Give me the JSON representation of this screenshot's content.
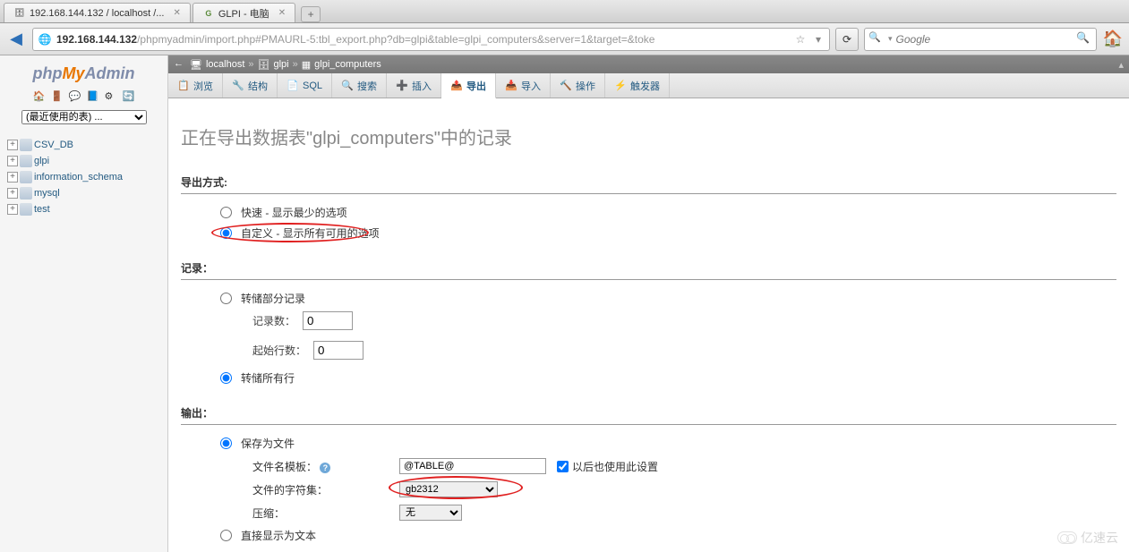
{
  "browser": {
    "tabs": [
      {
        "icon": "pma",
        "label": "192.168.144.132 / localhost /..."
      },
      {
        "icon": "glpi",
        "label": "GLPI - 电脑"
      }
    ],
    "url_host": "192.168.144.132",
    "url_path": "/phpmyadmin/import.php#PMAURL-5:tbl_export.php?db=glpi&table=glpi_computers&server=1&target=&toke",
    "search_placeholder": "Google"
  },
  "logo": {
    "p1": "php",
    "p2": "My",
    "p3": "Admin"
  },
  "recent_tables_label": "(最近使用的表) ...",
  "databases": [
    "CSV_DB",
    "glpi",
    "information_schema",
    "mysql",
    "test"
  ],
  "breadcrumb": {
    "server": "localhost",
    "db": "glpi",
    "table": "glpi_computers"
  },
  "tabs": [
    {
      "icon": "📋",
      "label": "浏览"
    },
    {
      "icon": "🔧",
      "label": "结构"
    },
    {
      "icon": "📄",
      "label": "SQL"
    },
    {
      "icon": "🔍",
      "label": "搜索"
    },
    {
      "icon": "➕",
      "label": "插入"
    },
    {
      "icon": "📤",
      "label": "导出",
      "active": true
    },
    {
      "icon": "📥",
      "label": "导入"
    },
    {
      "icon": "🔨",
      "label": "操作"
    },
    {
      "icon": "⚡",
      "label": "触发器"
    }
  ],
  "page_title": "正在导出数据表\"glpi_computers\"中的记录",
  "export_method": {
    "heading": "导出方式:",
    "quick": "快速 - 显示最少的选项",
    "custom": "自定义 - 显示所有可用的选项"
  },
  "rows": {
    "heading": "记录：",
    "dump_some": "转储部分记录",
    "num_rows_label": "记录数：",
    "num_rows_value": "0",
    "start_row_label": "起始行数：",
    "start_row_value": "0",
    "dump_all": "转储所有行"
  },
  "output": {
    "heading": "输出：",
    "save_to_file": "保存为文件",
    "filename_template_label": "文件名模板：",
    "filename_template_value": "@TABLE@",
    "use_for_future": "以后也使用此设置",
    "charset_label": "文件的字符集：",
    "charset_value": "gb2312",
    "compression_label": "压缩：",
    "compression_value": "无",
    "view_as_text": "直接显示为文本"
  },
  "watermark": "亿速云"
}
